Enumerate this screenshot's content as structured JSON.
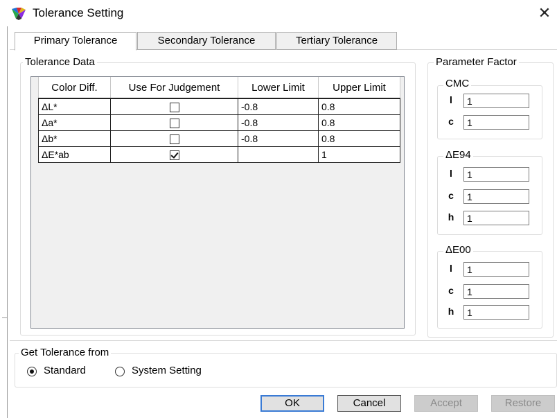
{
  "window": {
    "title": "Tolerance Setting",
    "close_glyph": "✕",
    "icon": "color-palette-icon"
  },
  "tabs": [
    {
      "label": "Primary Tolerance",
      "active": true
    },
    {
      "label": "Secondary Tolerance",
      "active": false
    },
    {
      "label": "Tertiary Tolerance",
      "active": false
    }
  ],
  "tolerance_data": {
    "group_label": "Tolerance Data",
    "columns": [
      "Color Diff.",
      "Use For Judgement",
      "Lower Limit",
      "Upper Limit"
    ],
    "rows": [
      {
        "name": "ΔL*",
        "use": false,
        "lower": "-0.8",
        "upper": "0.8"
      },
      {
        "name": "Δa*",
        "use": false,
        "lower": "-0.8",
        "upper": "0.8"
      },
      {
        "name": "Δb*",
        "use": false,
        "lower": "-0.8",
        "upper": "0.8"
      },
      {
        "name": "ΔE*ab",
        "use": true,
        "lower": "",
        "upper": "1"
      }
    ]
  },
  "parameter_factor": {
    "group_label": "Parameter Factor",
    "cmc": {
      "label": "CMC",
      "l_label": "l",
      "l": "1",
      "c_label": "c",
      "c": "1"
    },
    "de94": {
      "label": "ΔE94",
      "l_label": "l",
      "l": "1",
      "c_label": "c",
      "c": "1",
      "h_label": "h",
      "h": "1"
    },
    "de00": {
      "label": "ΔE00",
      "l_label": "l",
      "l": "1",
      "c_label": "c",
      "c": "1",
      "h_label": "h",
      "h": "1"
    }
  },
  "get_tolerance": {
    "group_label": "Get Tolerance from",
    "options": [
      {
        "label": "Standard",
        "selected": true
      },
      {
        "label": "System Setting",
        "selected": false
      }
    ]
  },
  "buttons": {
    "ok": "OK",
    "cancel": "Cancel",
    "accept": "Accept",
    "restore": "Restore"
  }
}
